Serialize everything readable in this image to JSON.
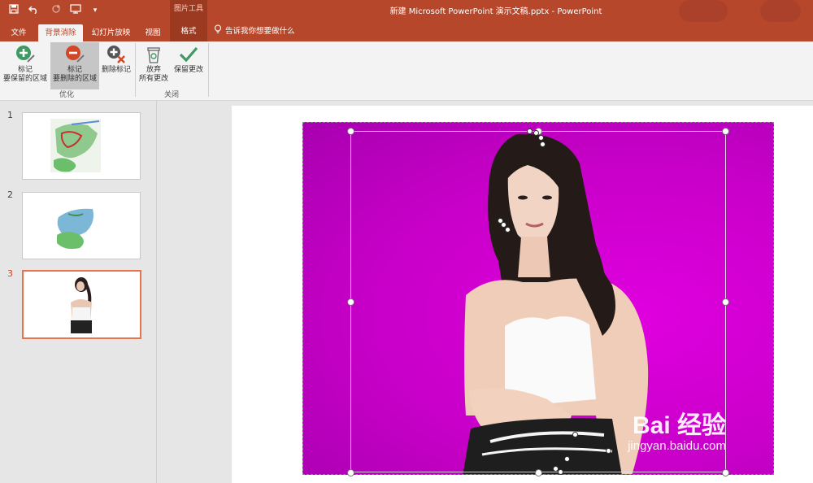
{
  "titlebar": {
    "context_group": "图片工具",
    "window_title": "新建 Microsoft PowerPoint 演示文稿.pptx - PowerPoint"
  },
  "quick_access": {
    "icons": [
      "save-icon",
      "undo-icon",
      "redo-icon",
      "present-icon",
      "customize-icon"
    ]
  },
  "tabs": [
    {
      "label": "文件"
    },
    {
      "label": "背景消除"
    },
    {
      "label": "幻灯片放映"
    },
    {
      "label": "视图"
    },
    {
      "label": "格式"
    }
  ],
  "tell_me": {
    "placeholder": "告诉我你想要做什么"
  },
  "ribbon": {
    "refine_group": "优化",
    "close_group": "关闭",
    "buttons": {
      "mark_keep": {
        "line1": "标记",
        "line2": "要保留的区域"
      },
      "mark_remove": {
        "line1": "标记",
        "line2": "要删除的区域"
      },
      "delete_mark": {
        "line1": "删除标记"
      },
      "discard": {
        "line1": "放弃",
        "line2": "所有更改"
      },
      "keep_changes": {
        "line1": "保留更改"
      }
    }
  },
  "slides": [
    {
      "number": "1"
    },
    {
      "number": "2"
    },
    {
      "number": "3"
    }
  ],
  "watermark": {
    "line1": "Bai  经验",
    "line2": "jingyan.baidu.com"
  },
  "colors": {
    "accent": "#b7472a",
    "context_tab": "#9c3a21",
    "removal_fill": "#d100d0",
    "selected_slide": "#e9734f"
  }
}
